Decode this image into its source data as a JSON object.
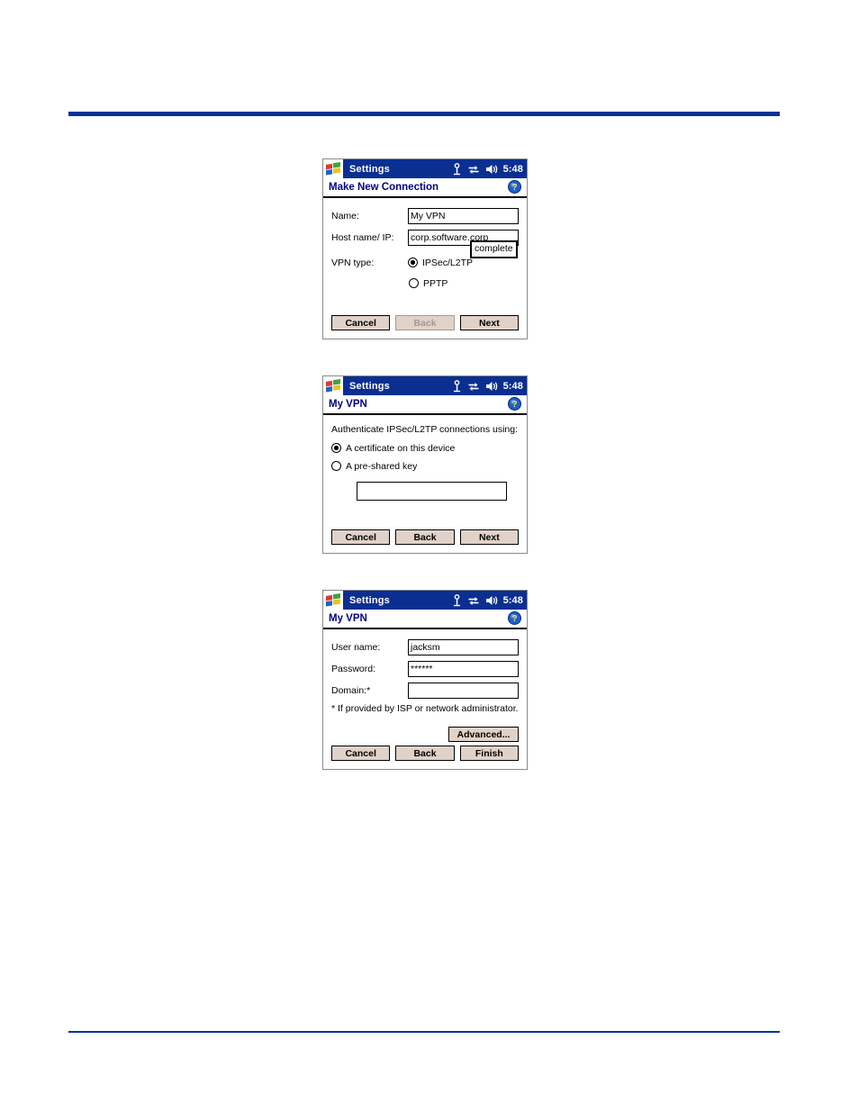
{
  "page": {
    "rule_color": "#00339a"
  },
  "screens": [
    {
      "id": "make-new-connection",
      "titlebar": {
        "app_title": "Settings",
        "clock": "5:48",
        "icons": [
          "signal-icon",
          "connectivity-icon",
          "volume-icon"
        ]
      },
      "caption": "Make New Connection",
      "help_icon": "help-icon",
      "fields": [
        {
          "label": "Name:",
          "value": "My VPN"
        },
        {
          "label": "Host name/ IP:",
          "value": "corp.software.corp"
        }
      ],
      "tooltip": "complete",
      "radio_group": {
        "label": "VPN type:",
        "options": [
          {
            "label": "IPSec/L2TP",
            "selected": true
          },
          {
            "label": "PPTP",
            "selected": false
          }
        ]
      },
      "buttons": [
        {
          "label": "Cancel",
          "disabled": false
        },
        {
          "label": "Back",
          "disabled": true
        },
        {
          "label": "Next",
          "disabled": false
        }
      ]
    },
    {
      "id": "my-vpn-auth",
      "titlebar": {
        "app_title": "Settings",
        "clock": "5:48",
        "icons": [
          "signal-icon",
          "connectivity-icon",
          "volume-icon"
        ]
      },
      "caption": "My VPN",
      "help_icon": "help-icon",
      "prompt": "Authenticate IPSec/L2TP connections using:",
      "radio_group": {
        "options": [
          {
            "label": "A certificate on this device",
            "selected": true
          },
          {
            "label": "A pre-shared key",
            "selected": false
          }
        ]
      },
      "pre_shared_key": {
        "value": "",
        "placeholder": ""
      },
      "buttons": [
        {
          "label": "Cancel",
          "disabled": false
        },
        {
          "label": "Back",
          "disabled": false
        },
        {
          "label": "Next",
          "disabled": false
        }
      ]
    },
    {
      "id": "my-vpn-credentials",
      "titlebar": {
        "app_title": "Settings",
        "clock": "5:48",
        "icons": [
          "signal-icon",
          "connectivity-icon",
          "volume-icon"
        ]
      },
      "caption": "My VPN",
      "help_icon": "help-icon",
      "fields": [
        {
          "label": "User name:",
          "value": "jacksm"
        },
        {
          "label": "Password:",
          "value": "******"
        },
        {
          "label": "Domain:*",
          "value": ""
        }
      ],
      "note": "* If provided by ISP or network administrator.",
      "advanced_button": "Advanced...",
      "buttons": [
        {
          "label": "Cancel",
          "disabled": false
        },
        {
          "label": "Back",
          "disabled": false
        },
        {
          "label": "Finish",
          "disabled": false
        }
      ]
    }
  ]
}
